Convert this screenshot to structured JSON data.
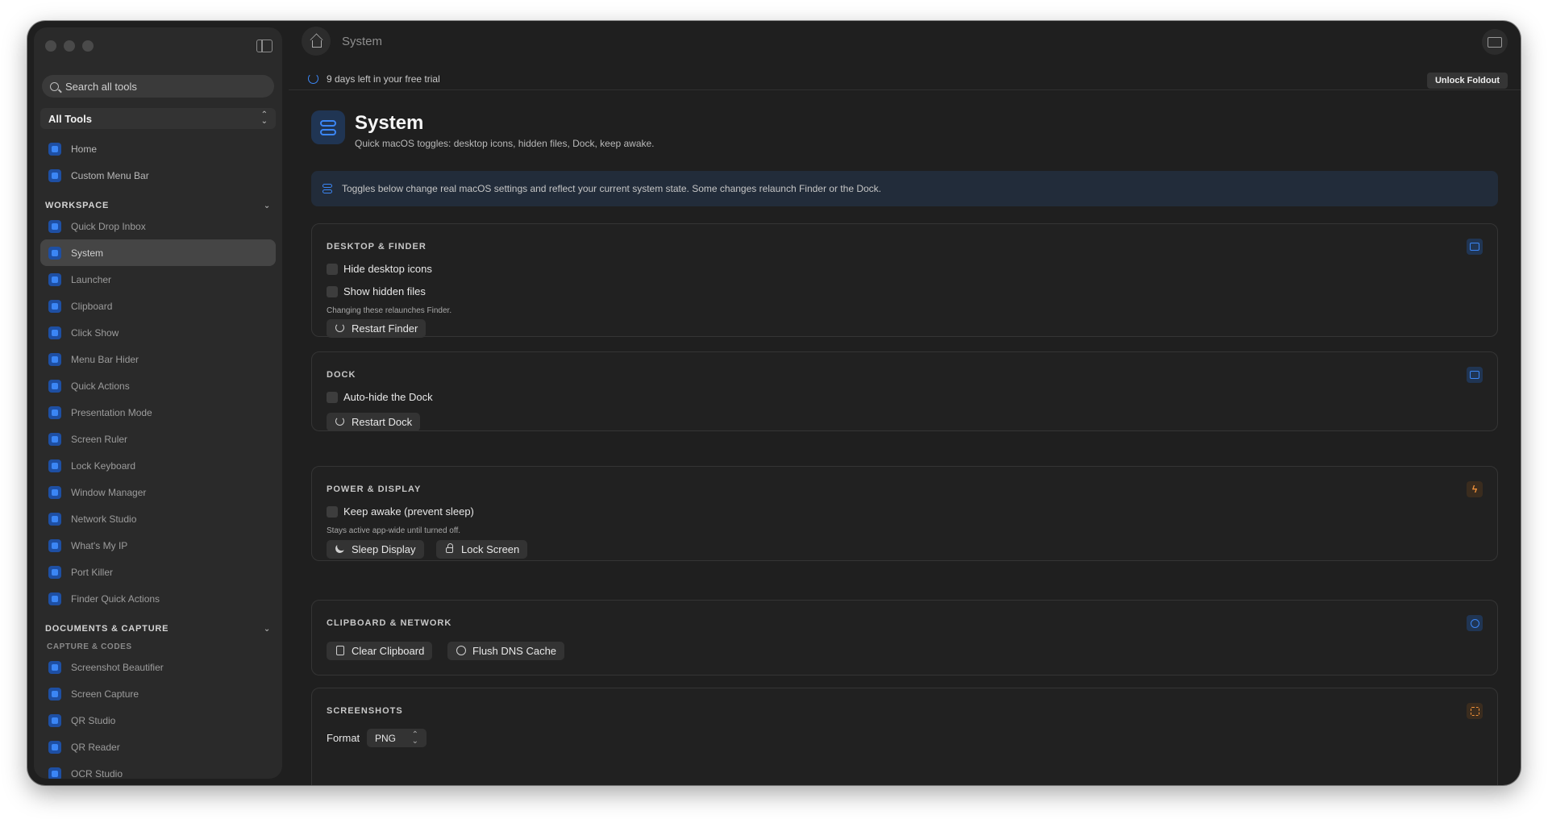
{
  "sidebar": {
    "search_placeholder": "Search all tools",
    "scope": "All Tools",
    "top_items": [
      {
        "label": "Home"
      },
      {
        "label": "Custom Menu Bar"
      }
    ],
    "workspace": {
      "title": "WORKSPACE",
      "items": [
        {
          "label": "Quick Drop Inbox"
        },
        {
          "label": "System"
        },
        {
          "label": "Launcher"
        },
        {
          "label": "Clipboard"
        },
        {
          "label": "Click Show"
        },
        {
          "label": "Menu Bar Hider"
        },
        {
          "label": "Quick Actions"
        },
        {
          "label": "Presentation Mode"
        },
        {
          "label": "Screen Ruler"
        },
        {
          "label": "Lock Keyboard"
        },
        {
          "label": "Window Manager"
        },
        {
          "label": "Network Studio"
        },
        {
          "label": "What's My IP"
        },
        {
          "label": "Port Killer"
        },
        {
          "label": "Finder Quick Actions"
        }
      ]
    },
    "documents": {
      "title": "DOCUMENTS & CAPTURE",
      "subtitle": "CAPTURE & CODES",
      "items": [
        {
          "label": "Screenshot Beautifier"
        },
        {
          "label": "Screen Capture"
        },
        {
          "label": "QR Studio"
        },
        {
          "label": "QR Reader"
        },
        {
          "label": "OCR Studio"
        }
      ]
    }
  },
  "topbar": {
    "title": "System"
  },
  "trial": {
    "text": "9 days left in your free trial",
    "unlock_label": "Unlock Foldout"
  },
  "page": {
    "title": "System",
    "subtitle": "Quick macOS toggles: desktop icons, hidden files, Dock, keep awake.",
    "notice": "Toggles below change real macOS settings and reflect your current system state. Some changes relaunch Finder or the Dock."
  },
  "cards": {
    "desktop": {
      "title": "DESKTOP & FINDER",
      "hide_icons": "Hide desktop icons",
      "show_hidden": "Show hidden files",
      "hint": "Changing these relaunches Finder.",
      "restart": "Restart Finder"
    },
    "dock": {
      "title": "DOCK",
      "autohide": "Auto-hide the Dock",
      "restart": "Restart Dock"
    },
    "power": {
      "title": "POWER & DISPLAY",
      "keep_awake": "Keep awake (prevent sleep)",
      "hint": "Stays active app-wide until turned off.",
      "sleep": "Sleep Display",
      "lock": "Lock Screen"
    },
    "clipnet": {
      "title": "CLIPBOARD & NETWORK",
      "clear": "Clear Clipboard",
      "flush": "Flush DNS Cache"
    },
    "screenshots": {
      "title": "SCREENSHOTS",
      "format_label": "Format",
      "format_value": "PNG"
    }
  },
  "colors": {
    "accent": "#3b86f5",
    "warning": "#f0913a",
    "background": "#1f1f1f",
    "sidebar": "#2a2a2a"
  }
}
